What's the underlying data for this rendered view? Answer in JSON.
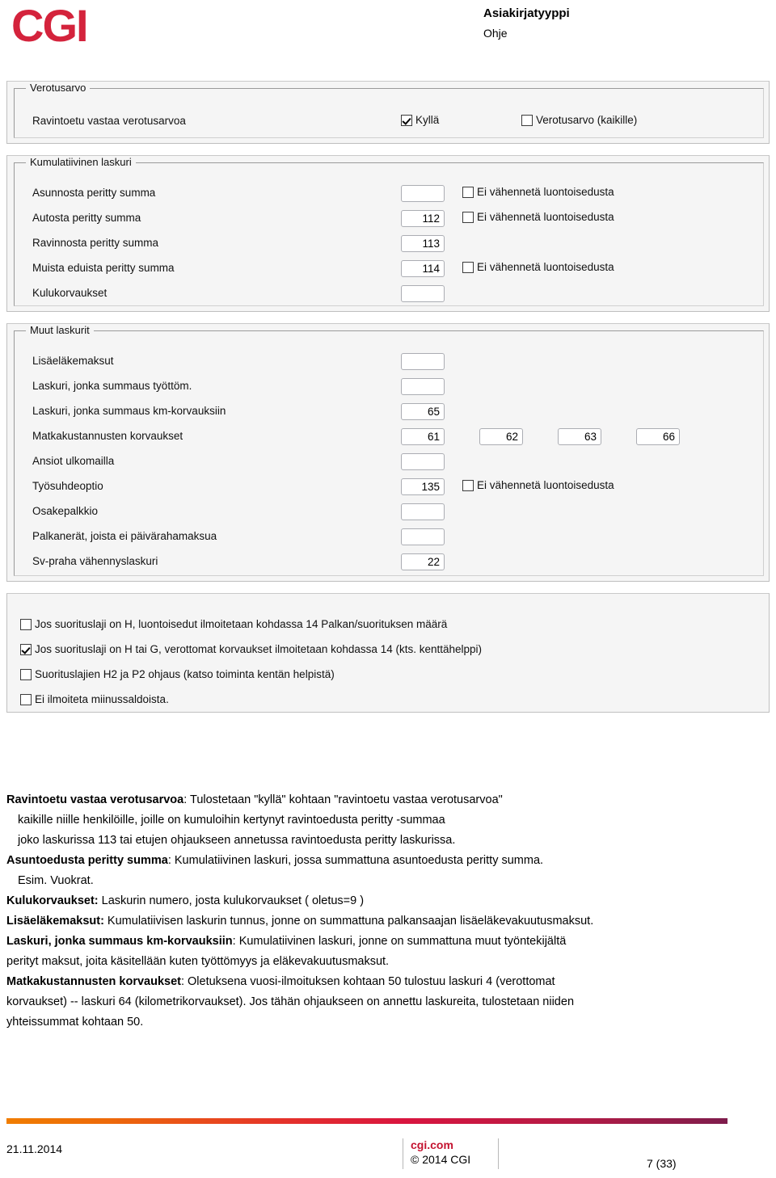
{
  "header": {
    "logo_text": "CGI",
    "logo_color": "#D4233C",
    "doc_type_label": "Asiakirjatyyppi",
    "doc_type_value": "Ohje"
  },
  "form": {
    "panels": [
      {
        "legend": "Verotusarvo",
        "rows": [
          {
            "label": "Ravintoetu vastaa verotusarvoa",
            "field": null,
            "checkboxes": [
              {
                "label": "Kyllä",
                "checked": true
              },
              {
                "label": "Verotusarvo (kaikille)",
                "checked": false
              }
            ]
          }
        ]
      },
      {
        "legend": "Kumulatiivinen laskuri",
        "rows": [
          {
            "label": "Asunnosta peritty summa",
            "field": "",
            "checkboxes": [
              {
                "label": "Ei vähennetä luontoisedusta",
                "checked": false
              }
            ]
          },
          {
            "label": "Autosta peritty summa",
            "field": "112",
            "checkboxes": [
              {
                "label": "Ei vähennetä luontoisedusta",
                "checked": false
              }
            ]
          },
          {
            "label": "Ravinnosta peritty summa",
            "field": "113",
            "checkboxes": []
          },
          {
            "label": "Muista eduista peritty summa",
            "field": "114",
            "checkboxes": [
              {
                "label": "Ei vähennetä luontoisedusta",
                "checked": false
              }
            ]
          },
          {
            "label": "Kulukorvaukset",
            "field": "",
            "checkboxes": []
          }
        ]
      },
      {
        "legend": "Muut laskurit",
        "rows": [
          {
            "label": "Lisäeläkemaksut",
            "field": "",
            "checkboxes": []
          },
          {
            "label": "Laskuri, jonka summaus työttöm.",
            "field": "",
            "checkboxes": []
          },
          {
            "label": "Laskuri, jonka summaus km-korvauksiin",
            "field": "65",
            "checkboxes": []
          },
          {
            "label": "Matkakustannusten korvaukset",
            "field": "61",
            "extra_fields": [
              "62",
              "63",
              "66"
            ],
            "checkboxes": []
          },
          {
            "label": "Ansiot ulkomailla",
            "field": "",
            "checkboxes": []
          },
          {
            "label": "Työsuhdeoptio",
            "field": "135",
            "checkboxes": [
              {
                "label": "Ei vähennetä luontoisedusta",
                "checked": false
              }
            ]
          },
          {
            "label": "Osakepalkkio",
            "field": "",
            "checkboxes": []
          },
          {
            "label": "Palkanerät, joista ei päivärahamaksua",
            "field": "",
            "checkboxes": []
          },
          {
            "label": "Sv-praha vähennyslaskuri",
            "field": "22",
            "checkboxes": []
          }
        ]
      },
      {
        "legend": "",
        "standalone_checkboxes": [
          {
            "label": "Jos suorituslaji on H, luontoisedut ilmoitetaan kohdassa 14 Palkan/suorituksen määrä",
            "checked": false
          },
          {
            "label": "Jos suorituslaji on H tai G, verottomat korvaukset ilmoitetaan kohdassa 14 (kts. kenttähelppi)",
            "checked": true
          },
          {
            "label": "Suorituslajien H2 ja P2 ohjaus (katso toiminta kentän helpistä)",
            "checked": false
          },
          {
            "label": "Ei ilmoiteta miinussaldoista.",
            "checked": false
          }
        ]
      }
    ]
  },
  "prose": {
    "p1_term": "Ravintoetu vastaa verotusarvoa",
    "p1_rest": ": Tulostetaan \"kyllä\" kohtaan \"ravintoetu vastaa verotusarvoa\"",
    "p1_line2": "kaikille niille henkilöille, joille on kumuloihin kertynyt ravintoedusta peritty -summaa",
    "p1_line3": "joko laskurissa 113 tai etujen ohjaukseen annetussa ravintoedusta peritty laskurissa.",
    "p2_term": "Asuntoedusta peritty summa",
    "p2_rest": ": Kumulatiivinen laskuri, jossa summattuna asuntoedusta peritty summa.",
    "p2_line2": "Esim. Vuokrat.",
    "p3_term": "Kulukorvaukset:",
    "p3_rest": " Laskurin numero, josta kulukorvaukset ( oletus=9 )",
    "p4_term": "Lisäeläkemaksut:",
    "p4_rest": " Kumulatiivisen laskurin tunnus, jonne on summattuna palkansaajan lisäeläkevakuutusmaksut.",
    "p5_term": "Laskuri, jonka summaus km-korvauksiin",
    "p5_rest": ": Kumulatiivinen laskuri, jonne on summattuna muut työntekijältä",
    "p5_line2": "perityt maksut, joita käsitellään kuten työttömyys ja eläkevakuutusmaksut.",
    "p6_term": "Matkakustannusten korvaukset",
    "p6_rest": ": Oletuksena vuosi-ilmoituksen kohtaan 50 tulostuu laskuri 4 (verottomat",
    "p6_line2": "korvaukset) -- laskuri 64 (kilometrikorvaukset). Jos tähän ohjaukseen on annettu laskureita, tulostetaan niiden",
    "p6_line3": "yhteissummat kohtaan 50."
  },
  "footer": {
    "date": "21.11.2014",
    "site": "cgi.com",
    "copyright": "© 2014 CGI",
    "page": "7 (33)",
    "rule_gradient_from": "#F07D00",
    "rule_gradient_to": "#7E1C4C"
  }
}
